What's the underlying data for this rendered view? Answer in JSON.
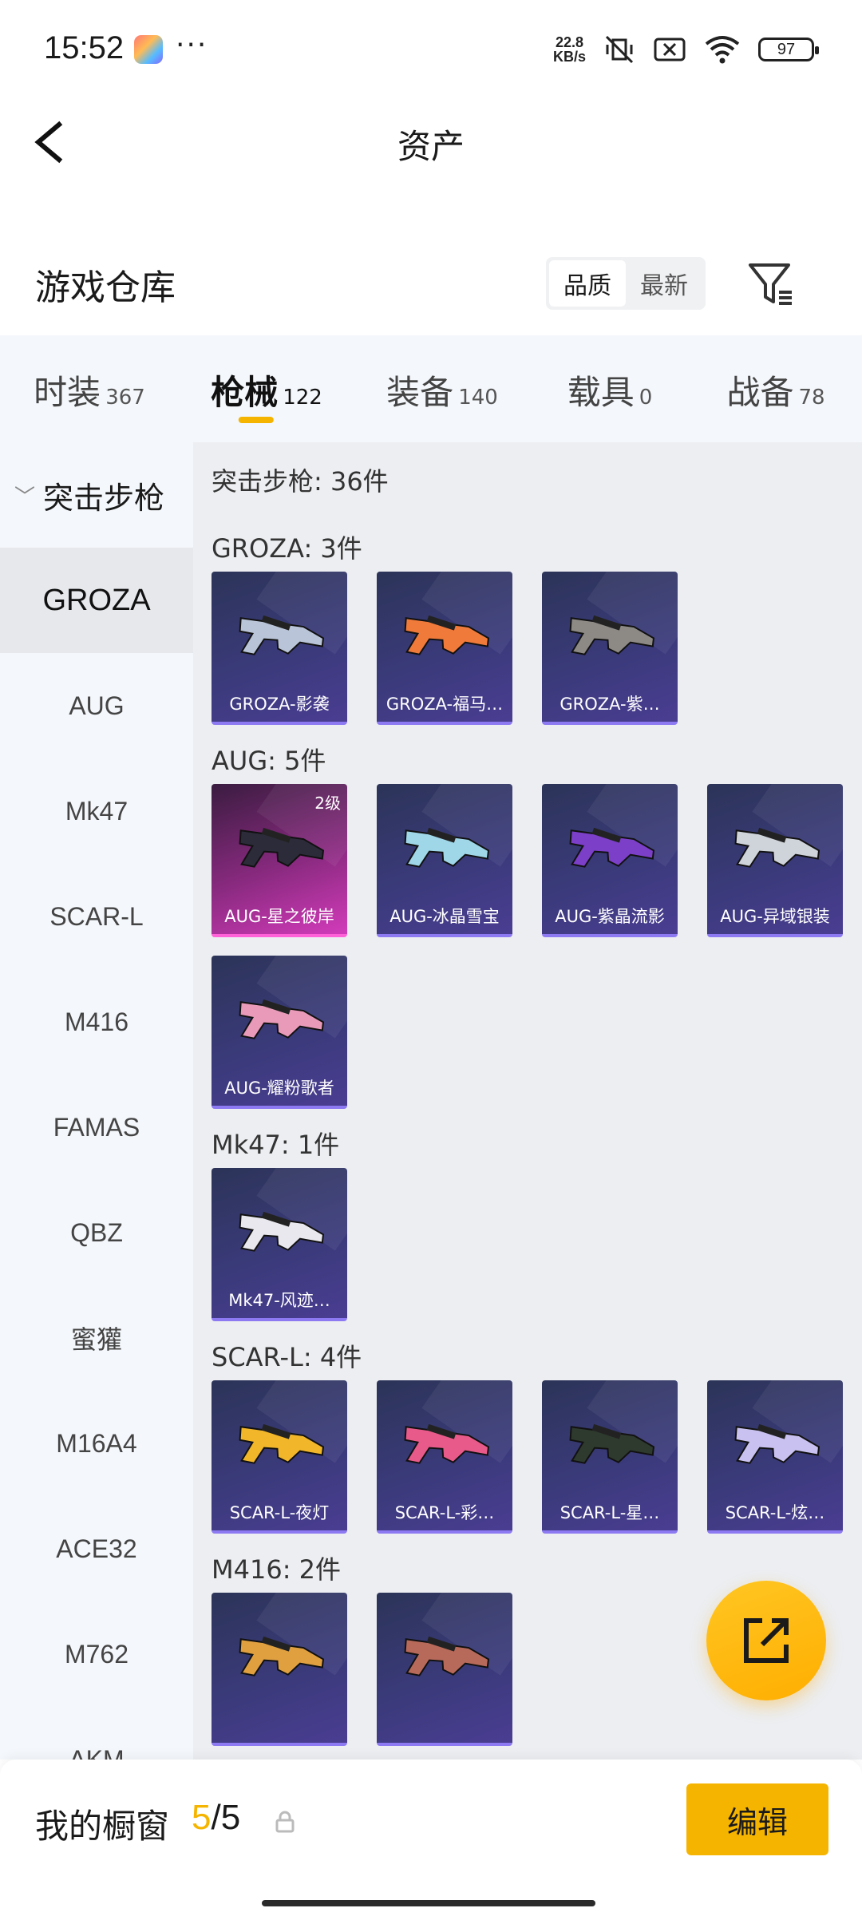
{
  "status_bar": {
    "time": "15:52",
    "more": "···",
    "net_speed_value": "22.8",
    "net_speed_unit": "KB/s",
    "battery": "97",
    "icons": [
      "game-app-icon",
      "vibrate-off-icon",
      "sim-x-icon",
      "wifi-icon",
      "battery-icon"
    ]
  },
  "header": {
    "title": "资产"
  },
  "repo": {
    "title": "游戏仓库",
    "sort_options": [
      "品质",
      "最新"
    ],
    "sort_selected": "品质"
  },
  "tabs": [
    {
      "label": "时装",
      "count": "367",
      "active": false
    },
    {
      "label": "枪械",
      "count": "122",
      "active": true
    },
    {
      "label": "装备",
      "count": "140",
      "active": false
    },
    {
      "label": "载具",
      "count": "0",
      "active": false
    },
    {
      "label": "战备",
      "count": "78",
      "active": false
    }
  ],
  "sidebar": {
    "group": "突击步枪",
    "items": [
      "GROZA",
      "AUG",
      "Mk47",
      "SCAR-L",
      "M416",
      "FAMAS",
      "QBZ",
      "蜜獾",
      "M16A4",
      "ACE32",
      "M762",
      "AKM"
    ],
    "active": "GROZA"
  },
  "main": {
    "summary": "突击步枪: 36件",
    "groups": [
      {
        "title": "GROZA: 3件",
        "items": [
          {
            "name": "GROZA-影袭",
            "style": "purple"
          },
          {
            "name": "GROZA-福马…",
            "style": "purple"
          },
          {
            "name": "GROZA-紫…",
            "style": "purple"
          }
        ]
      },
      {
        "title": "AUG: 5件",
        "items": [
          {
            "name": "AUG-星之彼岸",
            "style": "pink",
            "level": "2级"
          },
          {
            "name": "AUG-冰晶雪宝",
            "style": "purple"
          },
          {
            "name": "AUG-紫晶流影",
            "style": "purple"
          },
          {
            "name": "AUG-异域银装",
            "style": "purple"
          },
          {
            "name": "AUG-耀粉歌者",
            "style": "purple"
          }
        ]
      },
      {
        "title": "Mk47: 1件",
        "items": [
          {
            "name": "Mk47-风迹…",
            "style": "purple"
          }
        ]
      },
      {
        "title": "SCAR-L: 4件",
        "items": [
          {
            "name": "SCAR-L-夜灯",
            "style": "purple"
          },
          {
            "name": "SCAR-L-彩…",
            "style": "purple"
          },
          {
            "name": "SCAR-L-星…",
            "style": "purple"
          },
          {
            "name": "SCAR-L-炫…",
            "style": "purple"
          }
        ]
      },
      {
        "title": "M416: 2件",
        "items": [
          {
            "name": "",
            "style": "purple"
          },
          {
            "name": "",
            "style": "purple"
          }
        ]
      }
    ]
  },
  "bottom": {
    "window_label": "我的橱窗",
    "used": "5",
    "separator": "/",
    "total": "5",
    "edit_label": "编辑"
  },
  "colors": {
    "accent": "#f5b400",
    "card_purple": "#3a3a7a",
    "card_pink": "#d23bba"
  }
}
